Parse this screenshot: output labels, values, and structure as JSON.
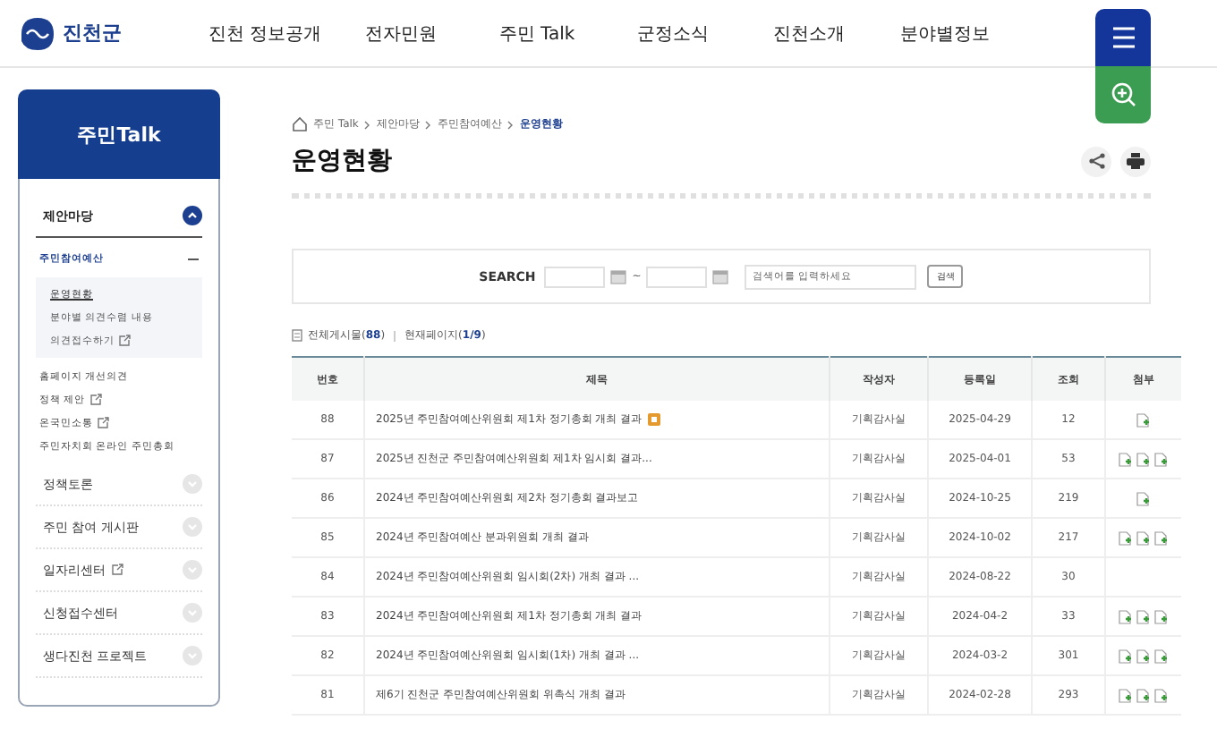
{
  "header": {
    "logo": "진천군",
    "nav": [
      "진천 정보공개",
      "전자민원",
      "주민 Talk",
      "군정소식",
      "진천소개",
      "분야별정보"
    ]
  },
  "sidebar": {
    "title": "주민Talk",
    "menu": [
      {
        "label": "제안마당",
        "expanded": true,
        "external": false,
        "children": [
          {
            "label": "주민참여예산",
            "kind": "group",
            "expanded": true,
            "external": false,
            "children": [
              {
                "label": "운영현황",
                "selected": true,
                "external": false
              },
              {
                "label": "분야별 의견수렴 내용",
                "selected": false,
                "external": false
              },
              {
                "label": "의견접수하기",
                "selected": false,
                "external": true
              }
            ]
          },
          {
            "label": "홈페이지 개선의견",
            "kind": "link",
            "external": false
          },
          {
            "label": "정책 제안",
            "kind": "link",
            "external": true
          },
          {
            "label": "온국민소통",
            "kind": "link",
            "external": true
          },
          {
            "label": "주민자치회 온라인 주민총회",
            "kind": "link",
            "external": false
          }
        ]
      },
      {
        "label": "정책토론",
        "expanded": false,
        "external": false
      },
      {
        "label": "주민 참여 게시판",
        "expanded": false,
        "external": false
      },
      {
        "label": "일자리센터",
        "expanded": false,
        "external": true
      },
      {
        "label": "신청접수센터",
        "expanded": false,
        "external": false
      },
      {
        "label": "생다진천 프로젝트",
        "expanded": false,
        "external": false
      }
    ]
  },
  "breadcrumb": [
    "주민 Talk",
    "제안마당",
    "주민참여예산",
    "운영현황"
  ],
  "page_title": "운영현황",
  "search": {
    "label": "SEARCH",
    "range_separator": "~",
    "placeholder": "검색어를 입력하세요",
    "button": "검색"
  },
  "summary": {
    "total": "전체게시물(**88**)",
    "page": "현재페이지(**1/9**)"
  },
  "table": {
    "columns": [
      "번호",
      "제목",
      "작성자",
      "등록일",
      "조회",
      "첨부"
    ],
    "rows": [
      {
        "number": "88",
        "title": "2025년 주민참여예산위원회 제1차 정기총회 개최 결과",
        "new": true,
        "author": "기획감사실",
        "date": "2025-04-29",
        "views": "12",
        "attachments": [
          {
            "kind": "file"
          }
        ]
      },
      {
        "number": "87",
        "title": "2025년 진천군 주민참여예산위원회 제1차 임시회 결과...",
        "new": false,
        "author": "기획감사실",
        "date": "2025-04-01",
        "views": "53",
        "attachments": [
          {
            "kind": "file"
          },
          {
            "kind": "file"
          },
          {
            "kind": "file"
          }
        ]
      },
      {
        "number": "86",
        "title": "2024년 주민참여예산위원회 제2차 정기총회 결과보고",
        "new": false,
        "author": "기획감사실",
        "date": "2024-10-25",
        "views": "219",
        "attachments": [
          {
            "kind": "file"
          }
        ]
      },
      {
        "number": "85",
        "title": "2024년 주민참여예산 분과위원회 개최 결과",
        "new": false,
        "author": "기획감사실",
        "date": "2024-10-02",
        "views": "217",
        "attachments": [
          {
            "kind": "file"
          },
          {
            "kind": "file"
          },
          {
            "kind": "file"
          }
        ]
      },
      {
        "number": "84",
        "title": "2024년 주민참여예산위원회 임시회(2차) 개최 결과 ...",
        "new": false,
        "author": "기획감사실",
        "date": "2024-08-22",
        "views": "30"
      },
      {
        "number": "83",
        "title": "2024년 주민참여예산위원회 제1차 정기총회 개최 결과",
        "new": false,
        "author": "기획감사실",
        "date": "2024-04-2",
        "views": "33",
        "attachments": [
          {
            "kind": "file"
          },
          {
            "kind": "file"
          },
          {
            "kind": "file"
          }
        ]
      },
      {
        "number": "82",
        "title": "2024년 주민참여예산위원회 임시회(1차) 개최 결과 ...",
        "new": false,
        "author": "기획감사실",
        "date": "2024-03-2",
        "views": "301",
        "attachments": [
          {
            "kind": "file"
          },
          {
            "kind": "file"
          },
          {
            "kind": "file"
          }
        ]
      },
      {
        "number": "81",
        "title": "제6기 진천군 주민참여예산위원회 위촉식 개최 결과",
        "new": false,
        "author": "기획감사실",
        "date": "2024-02-28",
        "views": "293",
        "attachments": [
          {
            "kind": "file"
          },
          {
            "kind": "file"
          },
          {
            "kind": "file"
          }
        ]
      }
    ]
  }
}
